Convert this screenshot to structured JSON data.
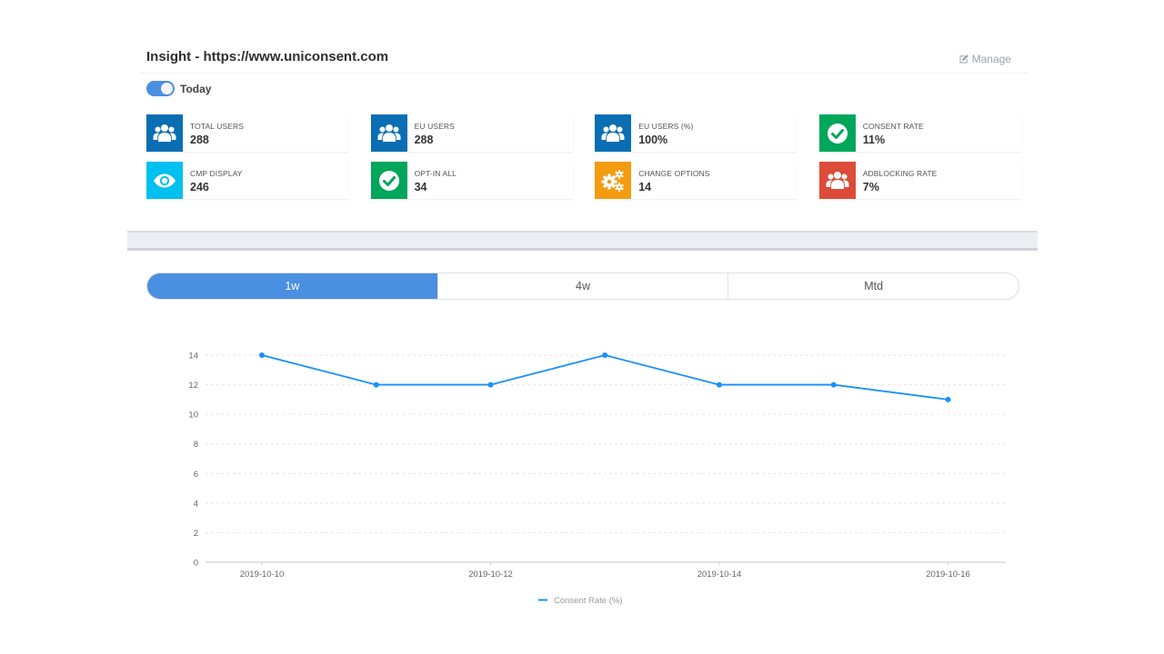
{
  "header": {
    "title": "Insight - https://www.uniconsent.com",
    "manage_label": "Manage",
    "manage_icon": "edit-icon"
  },
  "toggle": {
    "label": "Today",
    "on": true
  },
  "stats": [
    {
      "label": "TOTAL USERS",
      "value": "288",
      "icon": "users-icon",
      "color": "#0a6eb4"
    },
    {
      "label": "EU USERS",
      "value": "288",
      "icon": "users-icon",
      "color": "#0a6eb4"
    },
    {
      "label": "EU USERS (%)",
      "value": "100%",
      "icon": "users-icon",
      "color": "#0a6eb4"
    },
    {
      "label": "CONSENT RATE",
      "value": "11%",
      "icon": "check-circle-icon",
      "color": "#00a65a"
    },
    {
      "label": "CMP DISPLAY",
      "value": "246",
      "icon": "eye-icon",
      "color": "#00c0ef"
    },
    {
      "label": "OPT-IN ALL",
      "value": "34",
      "icon": "check-circle-icon",
      "color": "#00a65a"
    },
    {
      "label": "CHANGE OPTIONS",
      "value": "14",
      "icon": "gears-icon",
      "color": "#f39c12"
    },
    {
      "label": "ADBLOCKING RATE",
      "value": "7%",
      "icon": "users-icon",
      "color": "#dd4b39"
    }
  ],
  "tabs": [
    {
      "label": "1w",
      "active": true
    },
    {
      "label": "4w",
      "active": false
    },
    {
      "label": "Mtd",
      "active": false
    }
  ],
  "chart_data": {
    "type": "line",
    "title": "",
    "xlabel": "",
    "ylabel": "",
    "x": [
      "2019-10-10",
      "2019-10-11",
      "2019-10-12",
      "2019-10-13",
      "2019-10-14",
      "2019-10-15",
      "2019-10-16"
    ],
    "x_tick_labels": [
      "2019-10-10",
      "2019-10-12",
      "2019-10-14",
      "2019-10-16"
    ],
    "series": [
      {
        "name": "Consent Rate (%)",
        "values": [
          14,
          12,
          12,
          14,
          12,
          12,
          11
        ],
        "color": "#1890ff"
      }
    ],
    "ylim": [
      0,
      14
    ],
    "y_ticks": [
      0,
      2,
      4,
      6,
      8,
      10,
      12,
      14
    ],
    "grid": true,
    "legend": "bottom-center"
  }
}
